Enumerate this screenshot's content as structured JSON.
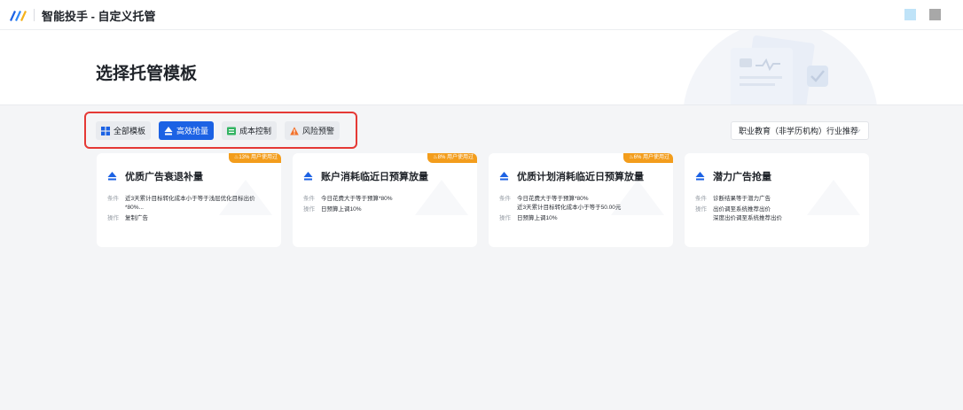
{
  "app": {
    "title": "智能投手 - 自定义托管",
    "logo_icon": "brand-logo-icon",
    "window_buttons": [
      "minimize-blue",
      "maximize-gray"
    ]
  },
  "page": {
    "title": "选择托管模板"
  },
  "filters": [
    {
      "label": "全部模板",
      "icon": "grid-icon",
      "active": false
    },
    {
      "label": "高效抢量",
      "icon": "boost-icon",
      "active": true
    },
    {
      "label": "成本控制",
      "icon": "cost-icon",
      "active": false
    },
    {
      "label": "风险预警",
      "icon": "warning-icon",
      "active": false
    }
  ],
  "industry_select": {
    "value": "职业教育（非学历机构）行业推荐"
  },
  "colors": {
    "accent": "#1c62e4",
    "badge": "#f39d1c",
    "highlight_border": "#e53935"
  },
  "cards": [
    {
      "title": "优质广告衰退补量",
      "badge": "13% 用户使用过",
      "condition_label": "条件",
      "conditions": [
        "近3天累计目标转化成本小于等于浅层优化目标出价",
        "*80%..."
      ],
      "action_label": "操作",
      "actions": [
        "复制广告"
      ]
    },
    {
      "title": "账户消耗临近日预算放量",
      "badge": "8% 用户使用过",
      "condition_label": "条件",
      "conditions": [
        "今日花费大于等于预算*80%"
      ],
      "action_label": "操作",
      "actions": [
        "日预算上调10%"
      ]
    },
    {
      "title": "优质计划消耗临近日预算放量",
      "badge": "6% 用户使用过",
      "condition_label": "条件",
      "conditions": [
        "今日花费大于等于预算*80%",
        "近3天累计目标转化成本小于等于50.00元"
      ],
      "action_label": "操作",
      "actions": [
        "日预算上调10%"
      ]
    },
    {
      "title": "潜力广告抢量",
      "badge": "",
      "condition_label": "条件",
      "conditions": [
        "诊断结果等于潜力广告"
      ],
      "action_label": "操作",
      "actions": [
        "出价调至系统推荐出价",
        "深度出价调至系统推荐出价"
      ]
    }
  ]
}
